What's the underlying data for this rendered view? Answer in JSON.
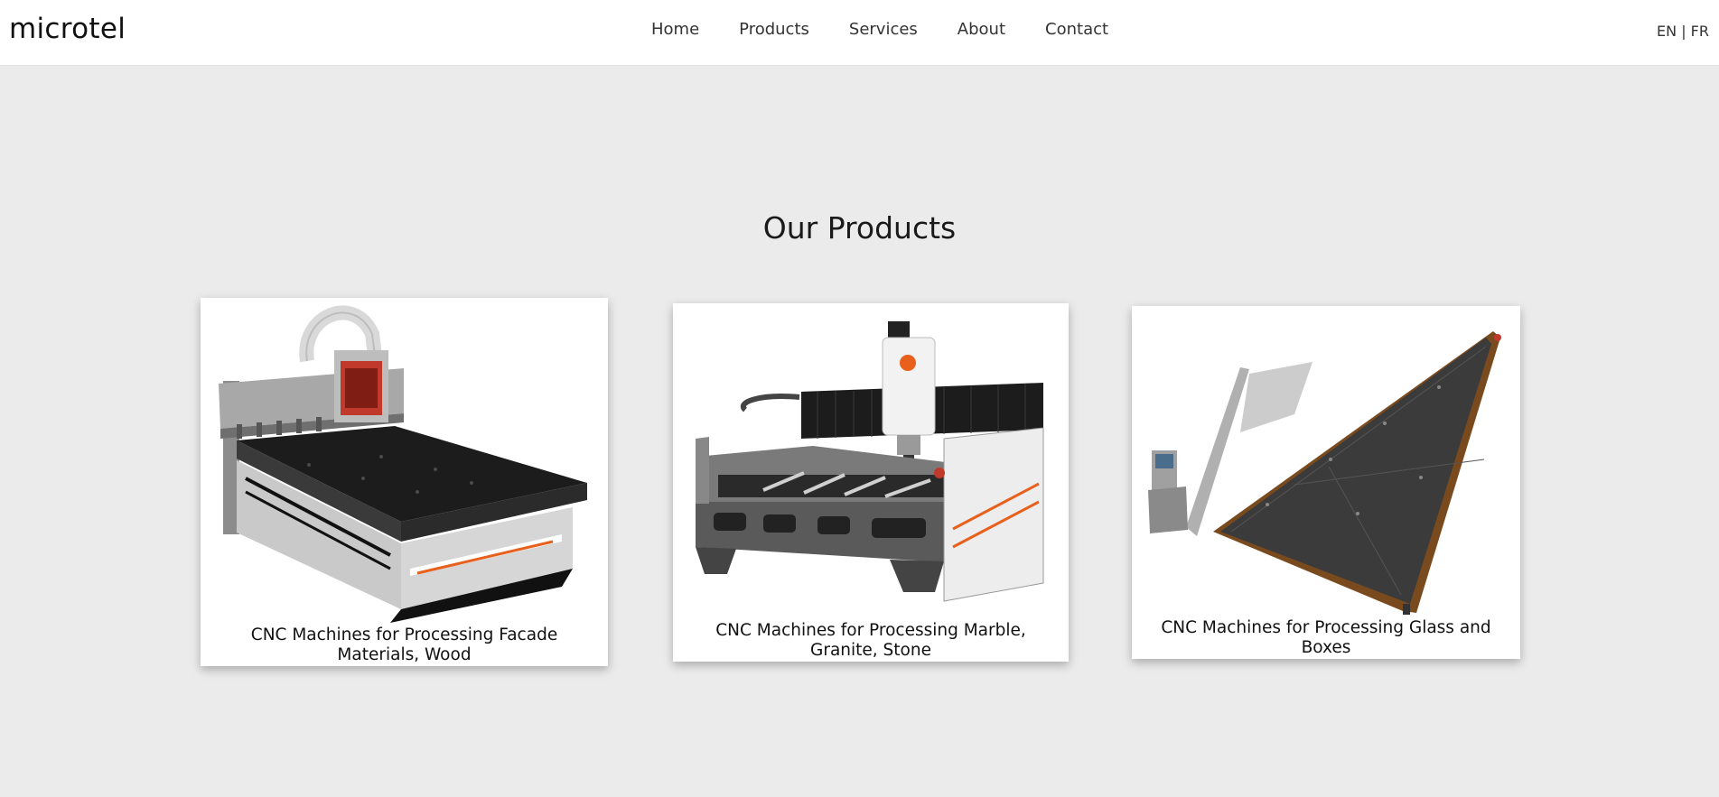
{
  "header": {
    "logo": "microtel",
    "nav": [
      "Home",
      "Products",
      "Services",
      "About",
      "Contact"
    ],
    "lang": {
      "en": "EN",
      "separator": " | ",
      "fr": "FR"
    }
  },
  "main": {
    "title": "Our Products",
    "products": [
      {
        "caption": "CNC Machines for Processing Facade Materials, Wood",
        "image": "cnc-router-wood-machine-image"
      },
      {
        "caption": "CNC Machines for Processing Marble, Granite, Stone",
        "image": "cnc-stone-bridge-machine-image"
      },
      {
        "caption": "CNC Machines for Processing Glass and Boxes",
        "image": "glass-processing-table-image"
      }
    ]
  },
  "colors": {
    "page_background": "#ebebeb",
    "header_background": "#ffffff",
    "accent_orange": "#e8601c"
  }
}
